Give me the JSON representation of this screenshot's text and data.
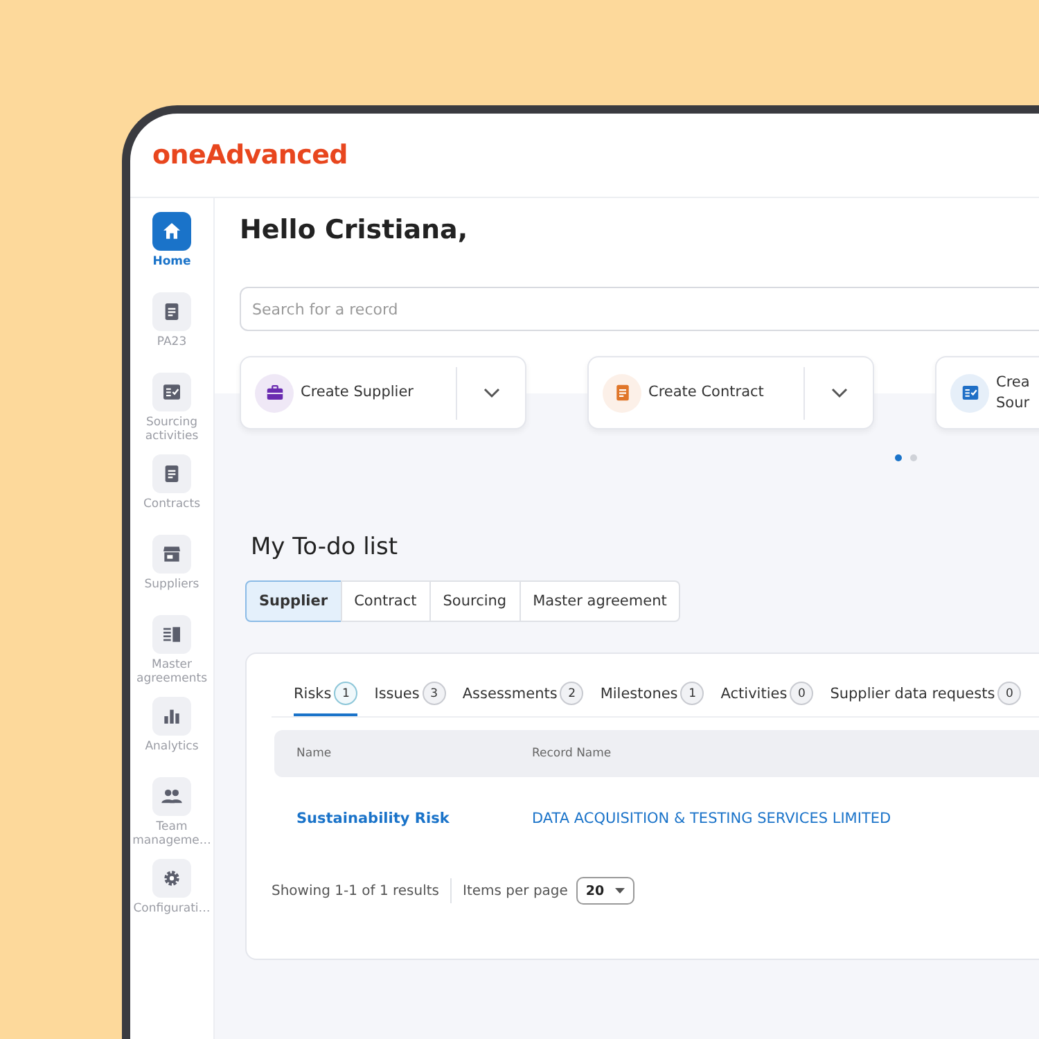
{
  "logo": "oneAdvanced",
  "sidebar": {
    "items": [
      {
        "label": "Home",
        "selected": true
      },
      {
        "label": "PA23",
        "selected": false
      },
      {
        "label": "Sourcing activities",
        "selected": false
      },
      {
        "label": "Contracts",
        "selected": false
      },
      {
        "label": "Suppliers",
        "selected": false
      },
      {
        "label": "Master agreements",
        "selected": false
      },
      {
        "label": "Analytics",
        "selected": false
      },
      {
        "label": "Team manageme…",
        "selected": false
      },
      {
        "label": "Configurati…",
        "selected": false
      }
    ]
  },
  "greeting": "Hello Cristiana,",
  "search": {
    "placeholder": "Search for a record"
  },
  "quick_actions": [
    {
      "label": "Create Supplier",
      "dropdown": true
    },
    {
      "label": "Create Contract",
      "dropdown": true
    },
    {
      "label": "Crea Sour",
      "dropdown": false
    }
  ],
  "carousel_dots": [
    {
      "selected": true
    },
    {
      "selected": false
    }
  ],
  "todo": {
    "title": "My To-do list",
    "tabs": [
      {
        "label": "Supplier",
        "selected": true
      },
      {
        "label": "Contract",
        "selected": false
      },
      {
        "label": "Sourcing",
        "selected": false
      },
      {
        "label": "Master agreement",
        "selected": false
      }
    ],
    "subtabs": [
      {
        "label": "Risks",
        "count": "1",
        "selected": true
      },
      {
        "label": "Issues",
        "count": "3",
        "selected": false
      },
      {
        "label": "Assessments",
        "count": "2",
        "selected": false
      },
      {
        "label": "Milestones",
        "count": "1",
        "selected": false
      },
      {
        "label": "Activities",
        "count": "0",
        "selected": false
      },
      {
        "label": "Supplier data requests",
        "count": "0",
        "selected": false
      }
    ],
    "table": {
      "columns": [
        "Name",
        "Record Name"
      ],
      "rows": [
        [
          "Sustainability Risk",
          "DATA ACQUISITION & TESTING SERVICES LIMITED"
        ]
      ]
    },
    "footer": {
      "summary": "Showing 1-1 of 1 results",
      "per_page_label": "Items per page",
      "per_page": "20"
    }
  }
}
